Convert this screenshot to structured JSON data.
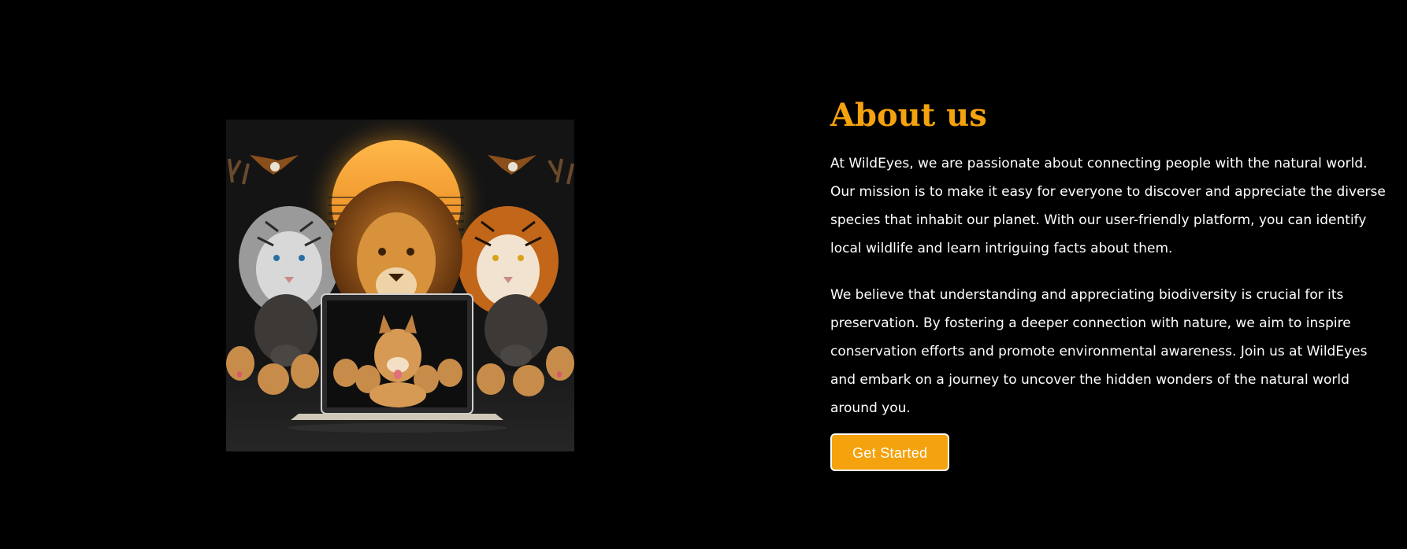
{
  "about": {
    "title": "About us",
    "paragraphs": [
      "At WildEyes, we are passionate about connecting people with the natural world. Our mission is to make it easy for everyone to discover and appreciate the diverse species that inhabit our planet. With our user-friendly platform, you can identify local wildlife and learn intriguing facts about them.",
      "We believe that understanding and appreciating biodiversity is crucial for its preservation. By fostering a deeper connection with nature, we aim to inspire conservation efforts and promote environmental awareness. Join us at WildEyes and embark on a journey to uncover the hidden wonders of the natural world around you."
    ],
    "cta_label": "Get Started"
  },
  "colors": {
    "accent": "#f4a20d",
    "background": "#000000",
    "text": "#ffffff"
  }
}
